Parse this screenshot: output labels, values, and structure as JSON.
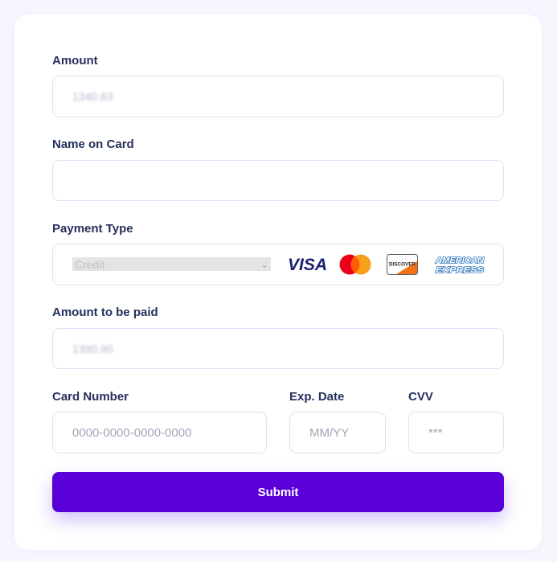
{
  "form": {
    "amount": {
      "label": "Amount",
      "value": "1340.63"
    },
    "name_on_card": {
      "label": "Name on Card",
      "value": ""
    },
    "payment_type": {
      "label": "Payment Type",
      "selected": "Credit",
      "brands": [
        "VISA",
        "Mastercard",
        "DISCOVER",
        "AMERICAN EXPRESS"
      ]
    },
    "amount_to_pay": {
      "label": "Amount to be paid",
      "value": "1390.90"
    },
    "card_number": {
      "label": "Card Number",
      "placeholder": "0000-0000-0000-0000"
    },
    "exp_date": {
      "label": "Exp. Date",
      "placeholder": "MM/YY"
    },
    "cvv": {
      "label": "CVV",
      "placeholder": "***"
    },
    "submit_label": "Submit"
  },
  "colors": {
    "page_bg": "#f7f6fe",
    "label": "#262f5c",
    "field_border": "#e2e0f7",
    "submit": "#5a00d8",
    "visa": "#1a1f71",
    "mc_red": "#eb001b",
    "mc_orange": "#f79e1b",
    "discover_orange": "#f47216",
    "amex": "#2e77bc"
  }
}
